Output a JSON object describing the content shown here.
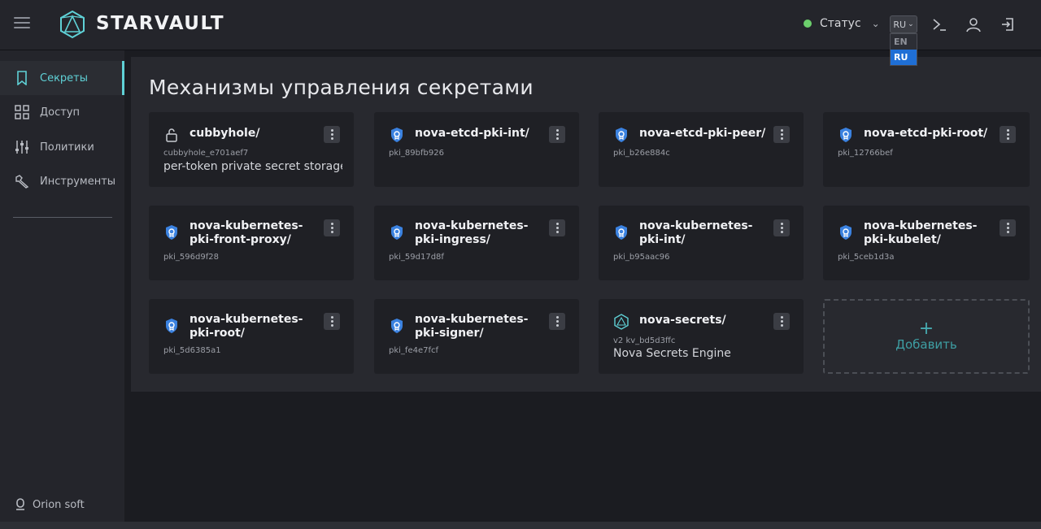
{
  "app": {
    "brand": "STARVAULT"
  },
  "header": {
    "status_label": "Статус",
    "status_color": "#6ccf6c",
    "language": {
      "current": "RU",
      "options": [
        "EN",
        "RU"
      ],
      "selected": "RU"
    },
    "icons": [
      "terminal-icon",
      "user-icon",
      "logout-icon"
    ]
  },
  "sidebar": {
    "items": [
      {
        "label": "Секреты",
        "icon": "bookmark-icon",
        "active": true
      },
      {
        "label": "Доступ",
        "icon": "grid-icon",
        "active": false
      },
      {
        "label": "Политики",
        "icon": "sliders-icon",
        "active": false
      },
      {
        "label": "Инструменты",
        "icon": "tools-icon",
        "active": false
      }
    ],
    "footer": "Orion soft"
  },
  "main": {
    "title": "Механизмы управления секретами",
    "add_label": "Добавить",
    "cards": [
      {
        "name": "cubbyhole/",
        "accessor": "cubbyhole_e701aef7",
        "description": "per-token private secret storage",
        "icon": "lock-icon"
      },
      {
        "name": "nova-etcd-pki-int/",
        "accessor": "pki_89bfb926",
        "description": "",
        "icon": "certificate-icon"
      },
      {
        "name": "nova-etcd-pki-peer/",
        "accessor": "pki_b26e884c",
        "description": "",
        "icon": "certificate-icon"
      },
      {
        "name": "nova-etcd-pki-root/",
        "accessor": "pki_12766bef",
        "description": "",
        "icon": "certificate-icon"
      },
      {
        "name": "nova-kubernetes-pki-front-proxy/",
        "accessor": "pki_596d9f28",
        "description": "",
        "icon": "certificate-icon"
      },
      {
        "name": "nova-kubernetes-pki-ingress/",
        "accessor": "pki_59d17d8f",
        "description": "",
        "icon": "certificate-icon"
      },
      {
        "name": "nova-kubernetes-pki-int/",
        "accessor": "pki_b95aac96",
        "description": "",
        "icon": "certificate-icon"
      },
      {
        "name": "nova-kubernetes-pki-kubelet/",
        "accessor": "pki_5ceb1d3a",
        "description": "",
        "icon": "certificate-icon"
      },
      {
        "name": "nova-kubernetes-pki-root/",
        "accessor": "pki_5d6385a1",
        "description": "",
        "icon": "certificate-icon"
      },
      {
        "name": "nova-kubernetes-pki-signer/",
        "accessor": "pki_fe4e7fcf",
        "description": "",
        "icon": "certificate-icon"
      },
      {
        "name": "nova-secrets/",
        "accessor": "v2 kv_bd5d3ffc",
        "description": "Nova Secrets Engine",
        "icon": "kv-icon"
      }
    ]
  }
}
